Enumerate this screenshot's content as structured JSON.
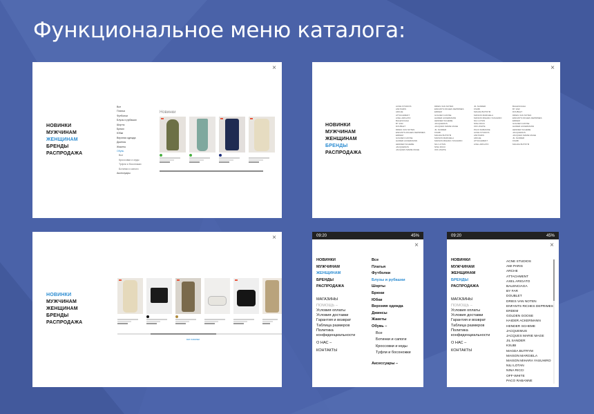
{
  "title": "Функциональное меню каталога:",
  "close_label": "×",
  "main_menu": [
    "НОВИНКИ",
    "МУЖЧИНАМ",
    "ЖЕНЩИНАМ",
    "БРЕНДЫ",
    "РАСПРОДАЖА"
  ],
  "colors": {
    "accent": "#2a8bd1",
    "background": "#4a62a8",
    "sale_tag": "#e8543c"
  },
  "panel1": {
    "active_index": 2,
    "categories": [
      "Все",
      "Платья",
      "Футболки",
      "Блузы и рубашки",
      "Шорты",
      "Брюки",
      "Юбки",
      "Верхняя одежда",
      "Джинсы",
      "Жакеты",
      "Обувь",
      "Все",
      "Кроссовки и кеды",
      "Туфли и босоножки",
      "Ботинки и сапоги",
      "Аксессуары"
    ],
    "products_title": "Новинки"
  },
  "panel2": {
    "active_index": 3
  },
  "panel3": {
    "active_index": 0,
    "show_more": "все новинки"
  },
  "mobile": {
    "time": "09:20",
    "battery": "45%",
    "secondary": [
      "МАГАЗИНЫ",
      "ПОМОЩЬ –",
      "Условия оплаты",
      "Условия доставки",
      "Гарантия и возврат",
      "Таблица размеров",
      "Политика",
      "конфиденциальности",
      "О НАС –",
      "КОНТАКТЫ"
    ]
  },
  "mobile1": {
    "active_index": 2,
    "categories": [
      "Все",
      "Платья",
      "Футболки",
      "Блузы и рубашки",
      "Шорты",
      "Брюки",
      "Юбки",
      "Верхняя одежда",
      "Джинсы",
      "Жакеты",
      "Обувь –",
      "Все",
      "Ботинки и сапоги",
      "Кроссовки и кеды",
      "Туфли и босоножки",
      "Аксессуары –"
    ]
  },
  "mobile2": {
    "active_index": 3,
    "brands": [
      "ACNE STUDIOS",
      "AMI PARIS",
      "ARCHE",
      "ATTACHMENT",
      "AXEL ARIGATO",
      "BALENCIAGA",
      "BY FAR",
      "DOUBLET",
      "DRIES VAN NOTEN",
      "ENFANTS RICHES DEPRIMES",
      "ERDEM",
      "GOLDEN GOOSE",
      "HAIDER ACKERMANN",
      "HENDER SCHEME",
      "JACQUEMUS",
      "JACQUES MARIE MAGE",
      "JIL SANDER",
      "KSUBI",
      "MAGDA BUTRYM",
      "MAISON MARGIELA",
      "MAISON MIHARA YASUHIRO",
      "NILI LOTAN",
      "NINA RICCI",
      "OFF-WHITE",
      "PACO RABANNE"
    ]
  }
}
